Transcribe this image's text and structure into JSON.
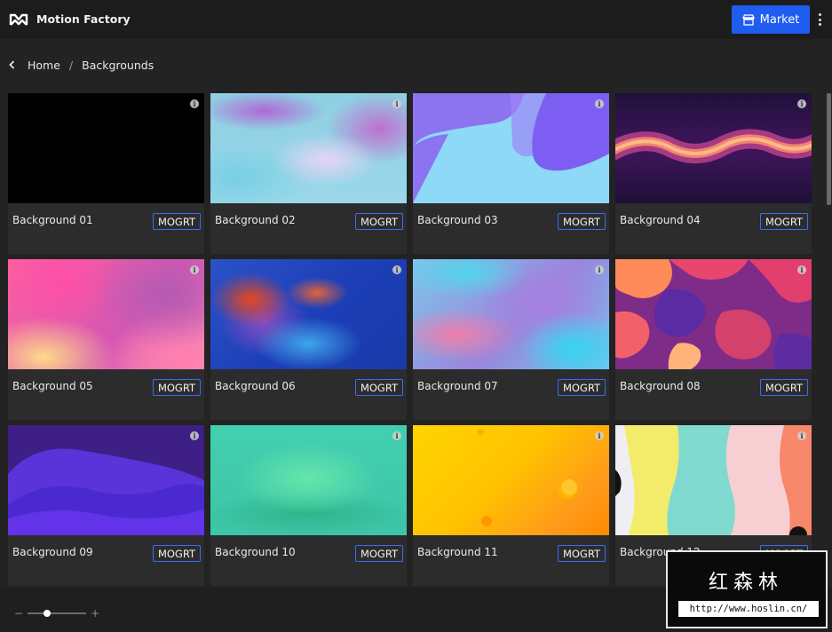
{
  "header": {
    "app_title": "Motion Factory",
    "market_label": "Market"
  },
  "breadcrumb": {
    "home": "Home",
    "separator": "/",
    "current": "Backgrounds"
  },
  "cards": [
    {
      "title": "Background 01",
      "badge": "MOGRT"
    },
    {
      "title": "Background 02",
      "badge": "MOGRT"
    },
    {
      "title": "Background 03",
      "badge": "MOGRT"
    },
    {
      "title": "Background 04",
      "badge": "MOGRT"
    },
    {
      "title": "Background 05",
      "badge": "MOGRT"
    },
    {
      "title": "Background 06",
      "badge": "MOGRT"
    },
    {
      "title": "Background 07",
      "badge": "MOGRT"
    },
    {
      "title": "Background 08",
      "badge": "MOGRT"
    },
    {
      "title": "Background 09",
      "badge": "MOGRT"
    },
    {
      "title": "Background 10",
      "badge": "MOGRT"
    },
    {
      "title": "Background 11",
      "badge": "MOGRT"
    },
    {
      "title": "Background 12",
      "badge": "MOGRT"
    }
  ],
  "zoom": {
    "minus": "−",
    "plus": "+",
    "level": 0.33
  },
  "watermark": {
    "title": "红森林",
    "url": "http://www.hoslin.cn/"
  },
  "colors": {
    "accent": "#1f5cf0",
    "badge_border": "#3a6df5",
    "background": "#232323"
  }
}
